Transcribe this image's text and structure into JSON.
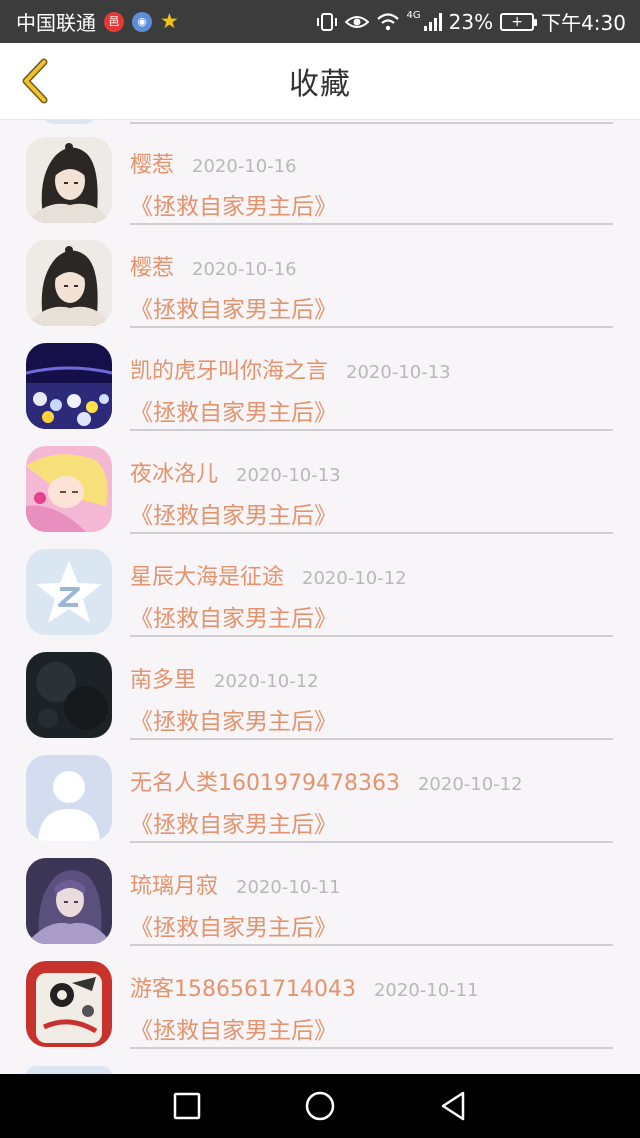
{
  "status_bar": {
    "carrier": "中国联通",
    "network": "4G",
    "battery": "23%",
    "time": "下午4:30"
  },
  "header": {
    "title": "收藏"
  },
  "items": [
    {
      "name": "樱惹",
      "date": "2020-10-16",
      "book": "《拯救自家男主后》",
      "avatar": "avatar-anime-ink-haired"
    },
    {
      "name": "樱惹",
      "date": "2020-10-16",
      "book": "《拯救自家男主后》",
      "avatar": "avatar-anime-ink-haired"
    },
    {
      "name": "凯的虎牙叫你海之言",
      "date": "2020-10-13",
      "book": "《拯救自家男主后》",
      "avatar": "avatar-concert-crowd"
    },
    {
      "name": "夜冰洛儿",
      "date": "2020-10-13",
      "book": "《拯救自家男主后》",
      "avatar": "avatar-blonde-girl-pink"
    },
    {
      "name": "星辰大海是征途",
      "date": "2020-10-12",
      "book": "《拯救自家男主后》",
      "avatar": "avatar-qq-star-logo"
    },
    {
      "name": "南多里",
      "date": "2020-10-12",
      "book": "《拯救自家男主后》",
      "avatar": "avatar-dark-texture"
    },
    {
      "name": "无名人类1601979478363",
      "date": "2020-10-12",
      "book": "《拯救自家男主后》",
      "avatar": "avatar-default-silhouette"
    },
    {
      "name": "琉璃月寂",
      "date": "2020-10-11",
      "book": "《拯救自家男主后》",
      "avatar": "avatar-anime-purple-hair"
    },
    {
      "name": "游客1586561714043",
      "date": "2020-10-11",
      "book": "《拯救自家男主后》",
      "avatar": "avatar-red-character"
    }
  ],
  "colors": {
    "accent": "#e3946e",
    "date_text": "#b8b8b8",
    "divider": "#cfcdcf",
    "background": "#f7f5f7",
    "status_bar": "#3c3c3c",
    "back_arrow": "#e0b020"
  },
  "nav": {
    "buttons": [
      "recents-square-icon",
      "home-circle-icon",
      "back-triangle-icon"
    ]
  }
}
